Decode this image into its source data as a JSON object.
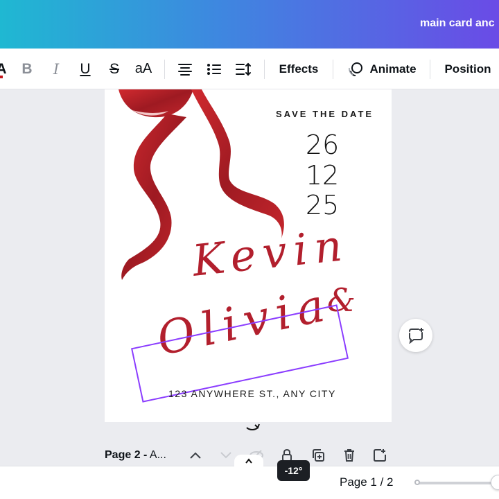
{
  "header": {
    "doc_title": "main card anc"
  },
  "toolbar": {
    "color_label": "A",
    "bold_label": "B",
    "italic_label": "I",
    "underline_label": "U",
    "strike_label": "S",
    "case_label": "aA",
    "effects_label": "Effects",
    "animate_label": "Animate",
    "position_label": "Position"
  },
  "card": {
    "save_the_date": "SAVE THE DATE",
    "date_day": "26",
    "date_month": "12",
    "date_year": "25",
    "name1": "Kevin",
    "ampersand": "&",
    "name2": "Olivia",
    "address": "123 ANYWHERE ST., ANY CITY"
  },
  "page_controls": {
    "page_label_bold": "Page 2 -",
    "page_label_rest": " A...",
    "rotation_badge": "-12°"
  },
  "footer": {
    "pages": "Page 1 / 2",
    "zoom_level": 1.0
  },
  "colors": {
    "accent": "#8b3dff",
    "ribbon_red": "#b21f2d",
    "gradient_start": "#1fb8d2",
    "gradient_end": "#6a4be6"
  }
}
